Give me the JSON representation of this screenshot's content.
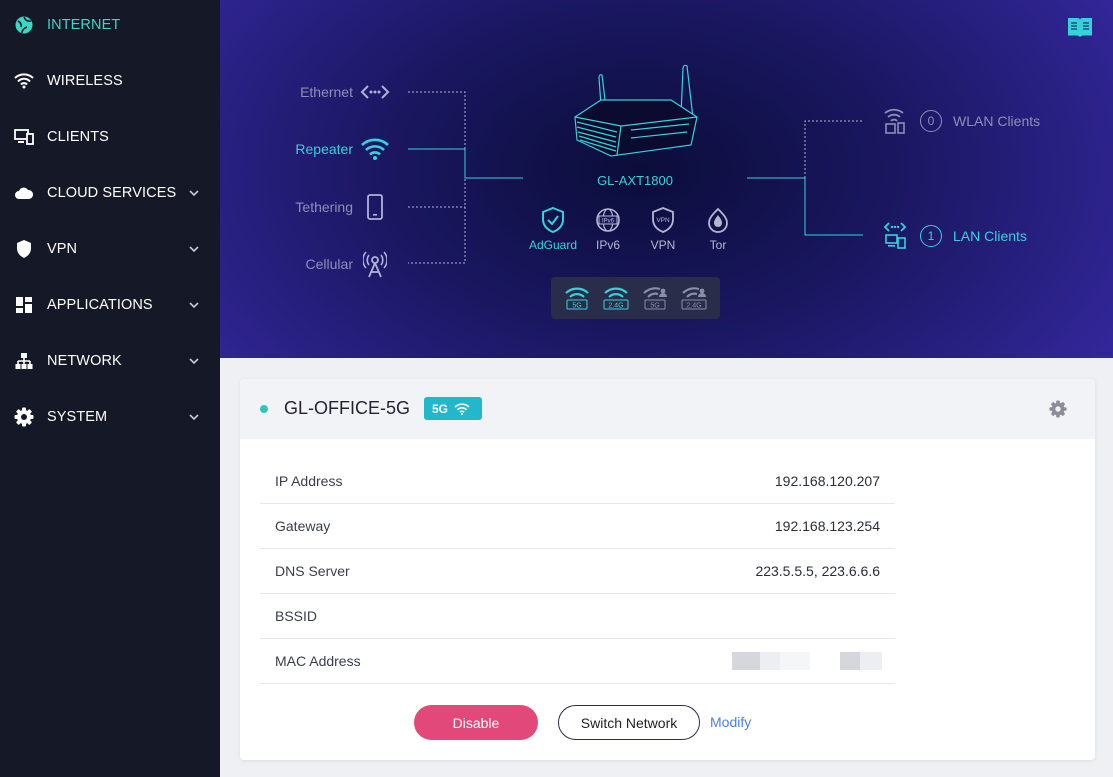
{
  "sidebar": {
    "items": [
      {
        "label": "INTERNET",
        "icon": "globe-icon",
        "active": true,
        "expandable": false
      },
      {
        "label": "WIRELESS",
        "icon": "wifi-icon",
        "active": false,
        "expandable": false
      },
      {
        "label": "CLIENTS",
        "icon": "clients-icon",
        "active": false,
        "expandable": false
      },
      {
        "label": "CLOUD SERVICES",
        "icon": "cloud-icon",
        "active": false,
        "expandable": true
      },
      {
        "label": "VPN",
        "icon": "shield-icon",
        "active": false,
        "expandable": true
      },
      {
        "label": "APPLICATIONS",
        "icon": "grid-icon",
        "active": false,
        "expandable": true
      },
      {
        "label": "NETWORK",
        "icon": "network-icon",
        "active": false,
        "expandable": true
      },
      {
        "label": "SYSTEM",
        "icon": "gear-icon",
        "active": false,
        "expandable": true
      }
    ]
  },
  "topology": {
    "sources": [
      {
        "label": "Ethernet",
        "icon": "ethernet-icon",
        "active": false
      },
      {
        "label": "Repeater",
        "icon": "wifi-icon",
        "active": true
      },
      {
        "label": "Tethering",
        "icon": "phone-icon",
        "active": false
      },
      {
        "label": "Cellular",
        "icon": "cell-tower-icon",
        "active": false
      }
    ],
    "device": "GL-AXT1800",
    "features": [
      {
        "label": "AdGuard",
        "icon": "adguard-shield-icon",
        "active": true
      },
      {
        "label": "IPv6",
        "icon": "ipv6-globe-icon",
        "active": false
      },
      {
        "label": "VPN",
        "icon": "vpn-shield-icon",
        "active": false
      },
      {
        "label": "Tor",
        "icon": "tor-onion-icon",
        "active": false
      }
    ],
    "bands": [
      {
        "label": "5G",
        "active": true
      },
      {
        "label": "2.4G",
        "active": true
      },
      {
        "label": "5G",
        "active": false
      },
      {
        "label": "2.4G",
        "active": false
      }
    ],
    "clients": [
      {
        "label": "WLAN Clients",
        "count": "0",
        "active": false
      },
      {
        "label": "LAN Clients",
        "count": "1",
        "active": true
      }
    ]
  },
  "network": {
    "ssid": "GL-OFFICE-5G",
    "band_badge": "5G",
    "rows": [
      {
        "key": "IP Address",
        "value": "192.168.120.207"
      },
      {
        "key": "Gateway",
        "value": "192.168.123.254"
      },
      {
        "key": "DNS Server",
        "value": "223.5.5.5, 223.6.6.6"
      },
      {
        "key": "BSSID",
        "value": ""
      },
      {
        "key": "MAC Address",
        "value": ""
      }
    ],
    "buttons": {
      "disable": "Disable",
      "switch": "Switch Network",
      "modify": "Modify"
    }
  },
  "colors": {
    "accent": "#34d3da",
    "active_nav": "#3ad6c6",
    "danger": "#e3487a",
    "link": "#4d7ef0",
    "sidebar_bg": "#151826"
  }
}
